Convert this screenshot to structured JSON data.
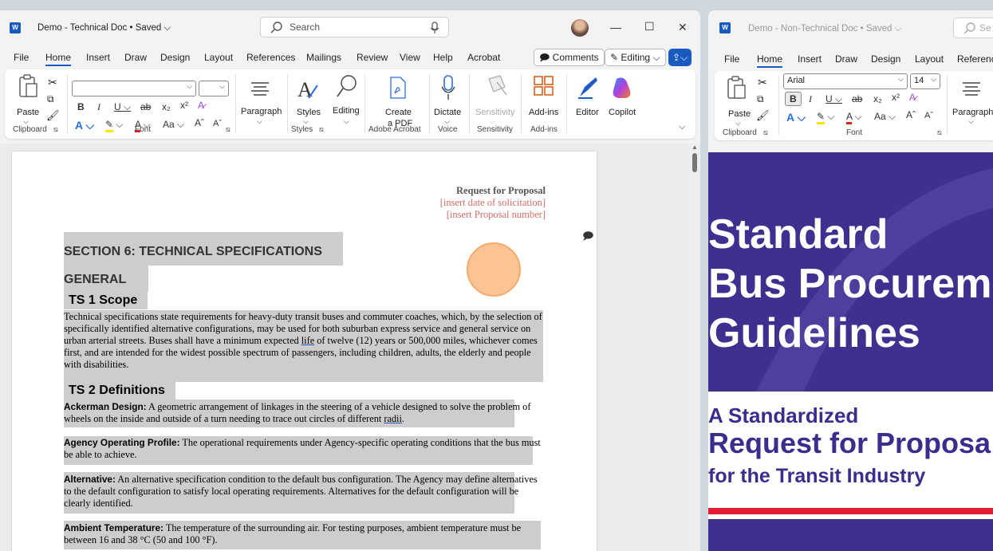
{
  "left_window": {
    "title": "Demo - Technical Doc • Saved",
    "search_placeholder": "Search",
    "tabs": [
      "File",
      "Home",
      "Insert",
      "Draw",
      "Design",
      "Layout",
      "References",
      "Mailings",
      "Review",
      "View",
      "Help",
      "Acrobat"
    ],
    "comments_label": "Comments",
    "editing_label": "Editing",
    "ribbon": {
      "paste": "Paste",
      "clipboard": "Clipboard",
      "font": "Font",
      "paragraph": "Paragraph",
      "styles": "Styles",
      "styles_group": "Styles",
      "editing": "Editing",
      "create_pdf_1": "Create",
      "create_pdf_2": "a PDF",
      "adobe_acrobat": "Adobe Acrobat",
      "dictate": "Dictate",
      "voice": "Voice",
      "sensitivity": "Sensitivity",
      "sensitivity_group": "Sensitivity",
      "addins": "Add-ins",
      "addins_group": "Add-ins",
      "editor": "Editor",
      "copilot": "Copilot",
      "font_name": "",
      "font_size": ""
    },
    "document": {
      "rfp_title": "Request for Proposal",
      "rfp_date": "[insert date of solicitation]",
      "rfp_number": "[insert Proposal number]",
      "section": "SECTION 6: TECHNICAL SPECIFICATIONS",
      "general": "GENERAL",
      "ts1": "TS 1 Scope",
      "scope_a": "Technical specifications state requirements for heavy-duty transit buses and commuter coaches, which, by the selection of specifically identified alternative configurations, may be used for both suburban express service and general service on urban arterial streets. Buses shall have a minimum expected ",
      "scope_link": "life",
      "scope_b": " of twelve (12) years or 500,000 miles, whichever comes first, and are intended for the widest possible spectrum of passengers, including children, adults, the elderly and people with disabilities.",
      "ts2": "TS 2 Definitions",
      "def1_term": "Ackerman Design:",
      "def1_a": " A geometric arrangement of linkages in the steering of a vehicle designed to solve the problem of wheels on the inside and outside of a turn needing to trace out circles of different ",
      "def1_link": "radii",
      "def1_b": ".",
      "def2_term": "Agency Operating Profile:",
      "def2_text": " The operational requirements under Agency-specific operating conditions that the bus must be able to achieve.",
      "def3_term": "Alternative:",
      "def3_text": " An alternative specification condition to the default bus configuration. The Agency may define alternatives to the default configuration to satisfy local operating requirements. Alternatives for the default configuration will be clearly identified.",
      "def4_term": "Ambient Temperature:",
      "def4_text": " The temperature of the surrounding air. For testing purposes, ambient temperature must be between 16 and 38 °C (50 and 100 °F)."
    }
  },
  "right_window": {
    "title": "Demo - Non-Technical Doc • Saved",
    "search_placeholder": "Se",
    "tabs": [
      "File",
      "Home",
      "Insert",
      "Draw",
      "Design",
      "Layout",
      "Referenc"
    ],
    "ribbon": {
      "paste": "Paste",
      "clipboard": "Clipboard",
      "font": "Font",
      "font_name": "Arial",
      "font_size": "14",
      "paragraph": "Paragraph"
    },
    "cover": {
      "line1": "Standard",
      "line2": "Bus Procurem",
      "line3": "Guidelines",
      "sub1": "A Standardized",
      "sub2": "Request for Proposa",
      "sub3": "for the Transit Industry"
    }
  }
}
